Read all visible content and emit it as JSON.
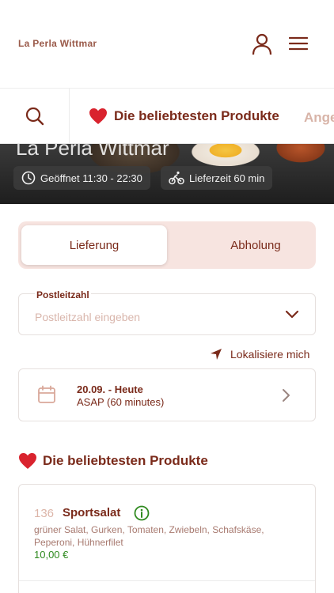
{
  "header": {
    "brand": "La Perla Wittmar"
  },
  "categories": {
    "active": "Die beliebtesten Produkte",
    "next": "Angebote"
  },
  "hero": {
    "title": "La Perla Wittmar",
    "opening": "Geöffnet 11:30 - 22:30",
    "delivery_time": "Lieferzeit 60 min"
  },
  "order_mode": {
    "delivery": "Lieferung",
    "pickup": "Abholung",
    "selected": "Lieferung"
  },
  "postcode": {
    "label": "Postleitzahl",
    "placeholder": "Postleitzahl eingeben"
  },
  "locate": {
    "label": "Lokalisiere mich"
  },
  "schedule": {
    "date": "20.09. - Heute",
    "time": "ASAP (60 minutes)"
  },
  "section": {
    "title": "Die beliebtesten Produkte"
  },
  "products": [
    {
      "number": "136",
      "name": "Sportsalat",
      "description": "grüner Salat, Gurken, Tomaten, Zwiebeln, Schafskäse, Peperoni, Hühnerfilet",
      "price": "10,00 €"
    }
  ],
  "colors": {
    "primary": "#7a2a1a",
    "accent_bg": "#f7e4e0",
    "price": "#2f8a1f",
    "heart": "#d9232e"
  },
  "icons": [
    "user-icon",
    "menu-icon",
    "search-icon",
    "heart-icon",
    "clock-icon",
    "bike-icon",
    "chevron-down-icon",
    "navigation-arrow-icon",
    "calendar-icon",
    "chevron-right-icon",
    "info-icon"
  ]
}
